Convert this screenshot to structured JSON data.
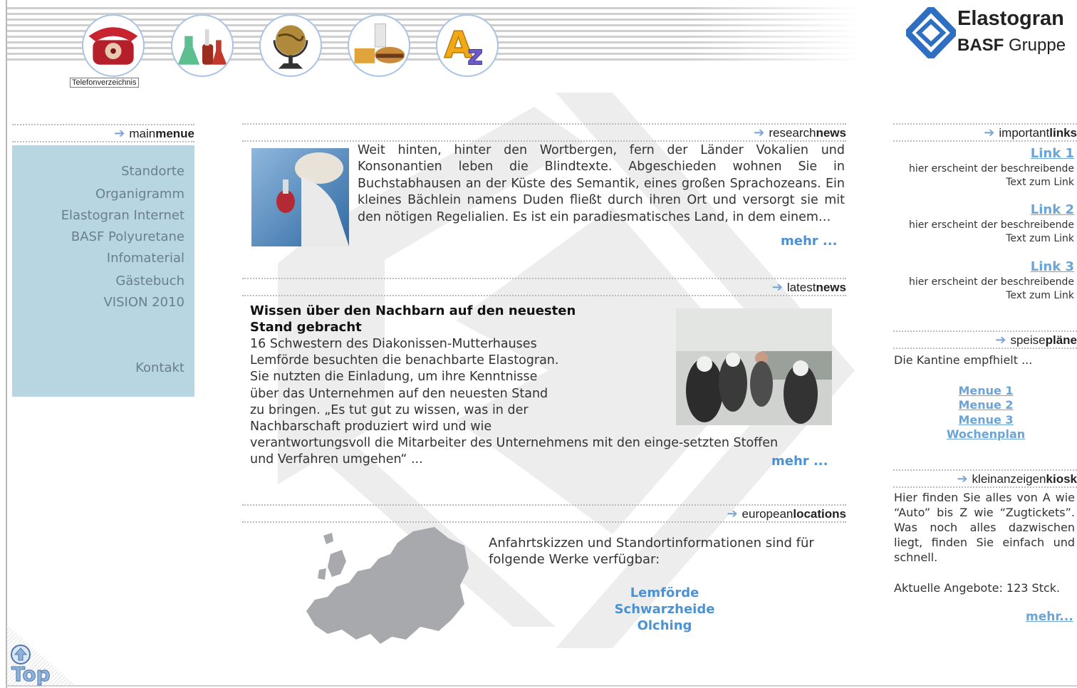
{
  "header": {
    "icons": [
      {
        "name": "telephone-icon",
        "tooltip": "Telefonverzeichnis"
      },
      {
        "name": "lab-flasks-icon"
      },
      {
        "name": "globe-icon"
      },
      {
        "name": "food-icon"
      },
      {
        "name": "az-index-icon"
      }
    ],
    "brand": {
      "name": "Elastogran",
      "sub_bold": "BASF",
      "sub": "Gruppe"
    }
  },
  "mainmenu": {
    "head_light": "main",
    "head_bold": "menue",
    "items": [
      "Standorte",
      "Organigramm",
      "Elastogran Internet",
      "BASF Polyuretane",
      "Infomaterial",
      "Gästebuch",
      "VISION 2010"
    ],
    "contact": "Kontakt"
  },
  "researchnews": {
    "head_light": "research",
    "head_bold": "news",
    "text": "Weit hinten, hinter den Wortbergen, fern der Länder Vokalien und Konsonantien leben die Blindtexte. Abgeschieden wohnen Sie in Buchstabhausen an der Küste des Semantik, eines großen Sprachozeans. Ein kleines Bächlein namens Duden fließt durch ihren Ort und versorgt sie mit den nötigen Regelialien. Es ist ein paradiesmatisches Land, in dem einem…",
    "more": "mehr ..."
  },
  "latestnews": {
    "head_light": "latest",
    "head_bold": "news",
    "headline_1": "Wissen über den Nachbarn auf den neuesten",
    "headline_2": "Stand gebracht",
    "lines": [
      "16 Schwestern des Diakonissen-Mutterhauses",
      "Lemförde besuchten die benachbarte Elastogran.",
      "Sie nutzten die Einladung, um ihre Kenntnisse",
      "über das Unternehmen auf den neuesten Stand",
      "zu bringen. „Es tut gut zu wissen, was in der",
      "Nachbarschaft produziert wird und wie",
      "verantwortungsvoll die Mitarbeiter des Unternehmens mit den einge-setzten Stoffen",
      "und Verfahren umgehen“ ..."
    ],
    "more": "mehr ..."
  },
  "europeanlocations": {
    "head_light": "european",
    "head_bold": "locations",
    "text": "Anfahrtskizzen und Standortinformationen sind für folgende Werke verfügbar:",
    "locations": [
      "Lemförde",
      "Schwarzheide",
      "Olching"
    ]
  },
  "importantlinks": {
    "head_light": "important",
    "head_bold": "links",
    "items": [
      {
        "label": "Link 1",
        "desc_1": "hier erscheint der beschreibende",
        "desc_2": "Text zum Link"
      },
      {
        "label": "Link 2",
        "desc_1": "hier erscheint der beschreibende",
        "desc_2": "Text zum Link"
      },
      {
        "label": "Link 3",
        "desc_1": "hier erscheint der beschreibende",
        "desc_2": "Text zum Link"
      }
    ]
  },
  "speiseplaene": {
    "head_light": "speise",
    "head_bold": "pläne",
    "intro": "Die Kantine empfhielt ...",
    "menus": [
      "Menue 1",
      "Menue 2",
      "Menue 3",
      "Wochenplan"
    ]
  },
  "kiosk": {
    "head_light": "kleinanzeigen",
    "head_bold": "kiosk",
    "text": "Hier finden Sie alles von A wie “Auto” bis Z wie “Zugtickets”. Was noch alles dazwischen liegt, finden Sie einfach und schnell.",
    "offers": "Aktuelle Angebote: 123 Stck.",
    "more": "mehr..."
  },
  "footer": {
    "top_label": "Top"
  },
  "colors": {
    "accent": "#4a92d4",
    "menu_bg": "#b7d6e2",
    "menu_text": "#6b7f8a",
    "brand_blue": "#2e6fc2"
  }
}
